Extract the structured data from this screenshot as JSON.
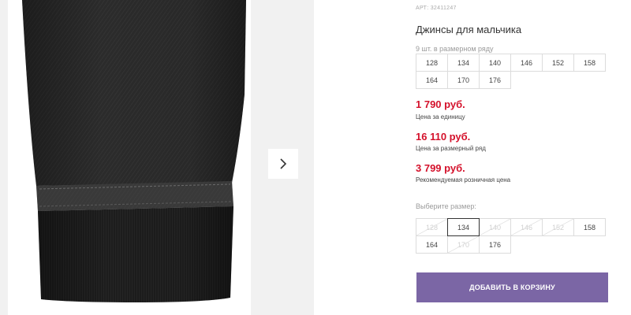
{
  "product": {
    "article": "АРТ: 32411247",
    "title": "Джинсы для мальчика",
    "pack_note": "9 шт. в размерном ряду",
    "pack_sizes": [
      "128",
      "134",
      "140",
      "146",
      "152",
      "158",
      "164",
      "170",
      "176"
    ]
  },
  "prices": {
    "unit_price": "1 790 руб.",
    "unit_label": "Цена за единицу",
    "pack_price": "16 110 руб.",
    "pack_label": "Цена за размерный ряд",
    "retail_price": "3 799 руб.",
    "retail_label": "Рекомендуемая розничная цена"
  },
  "size_selector": {
    "label": "Выберите размер:",
    "sizes": [
      {
        "label": "128",
        "state": "disabled"
      },
      {
        "label": "134",
        "state": "selected"
      },
      {
        "label": "140",
        "state": "disabled"
      },
      {
        "label": "146",
        "state": "disabled"
      },
      {
        "label": "152",
        "state": "disabled"
      },
      {
        "label": "158",
        "state": "available"
      },
      {
        "label": "164",
        "state": "available"
      },
      {
        "label": "170",
        "state": "disabled"
      },
      {
        "label": "176",
        "state": "available"
      }
    ]
  },
  "actions": {
    "add_to_cart": "ДОБАВИТЬ В КОРЗИНУ"
  },
  "gallery": {
    "next_icon": "chevron-right-icon"
  },
  "colors": {
    "price_red": "#d4112b",
    "button_purple": "#7b66a5",
    "denim_dark": "#2a2a2a"
  }
}
